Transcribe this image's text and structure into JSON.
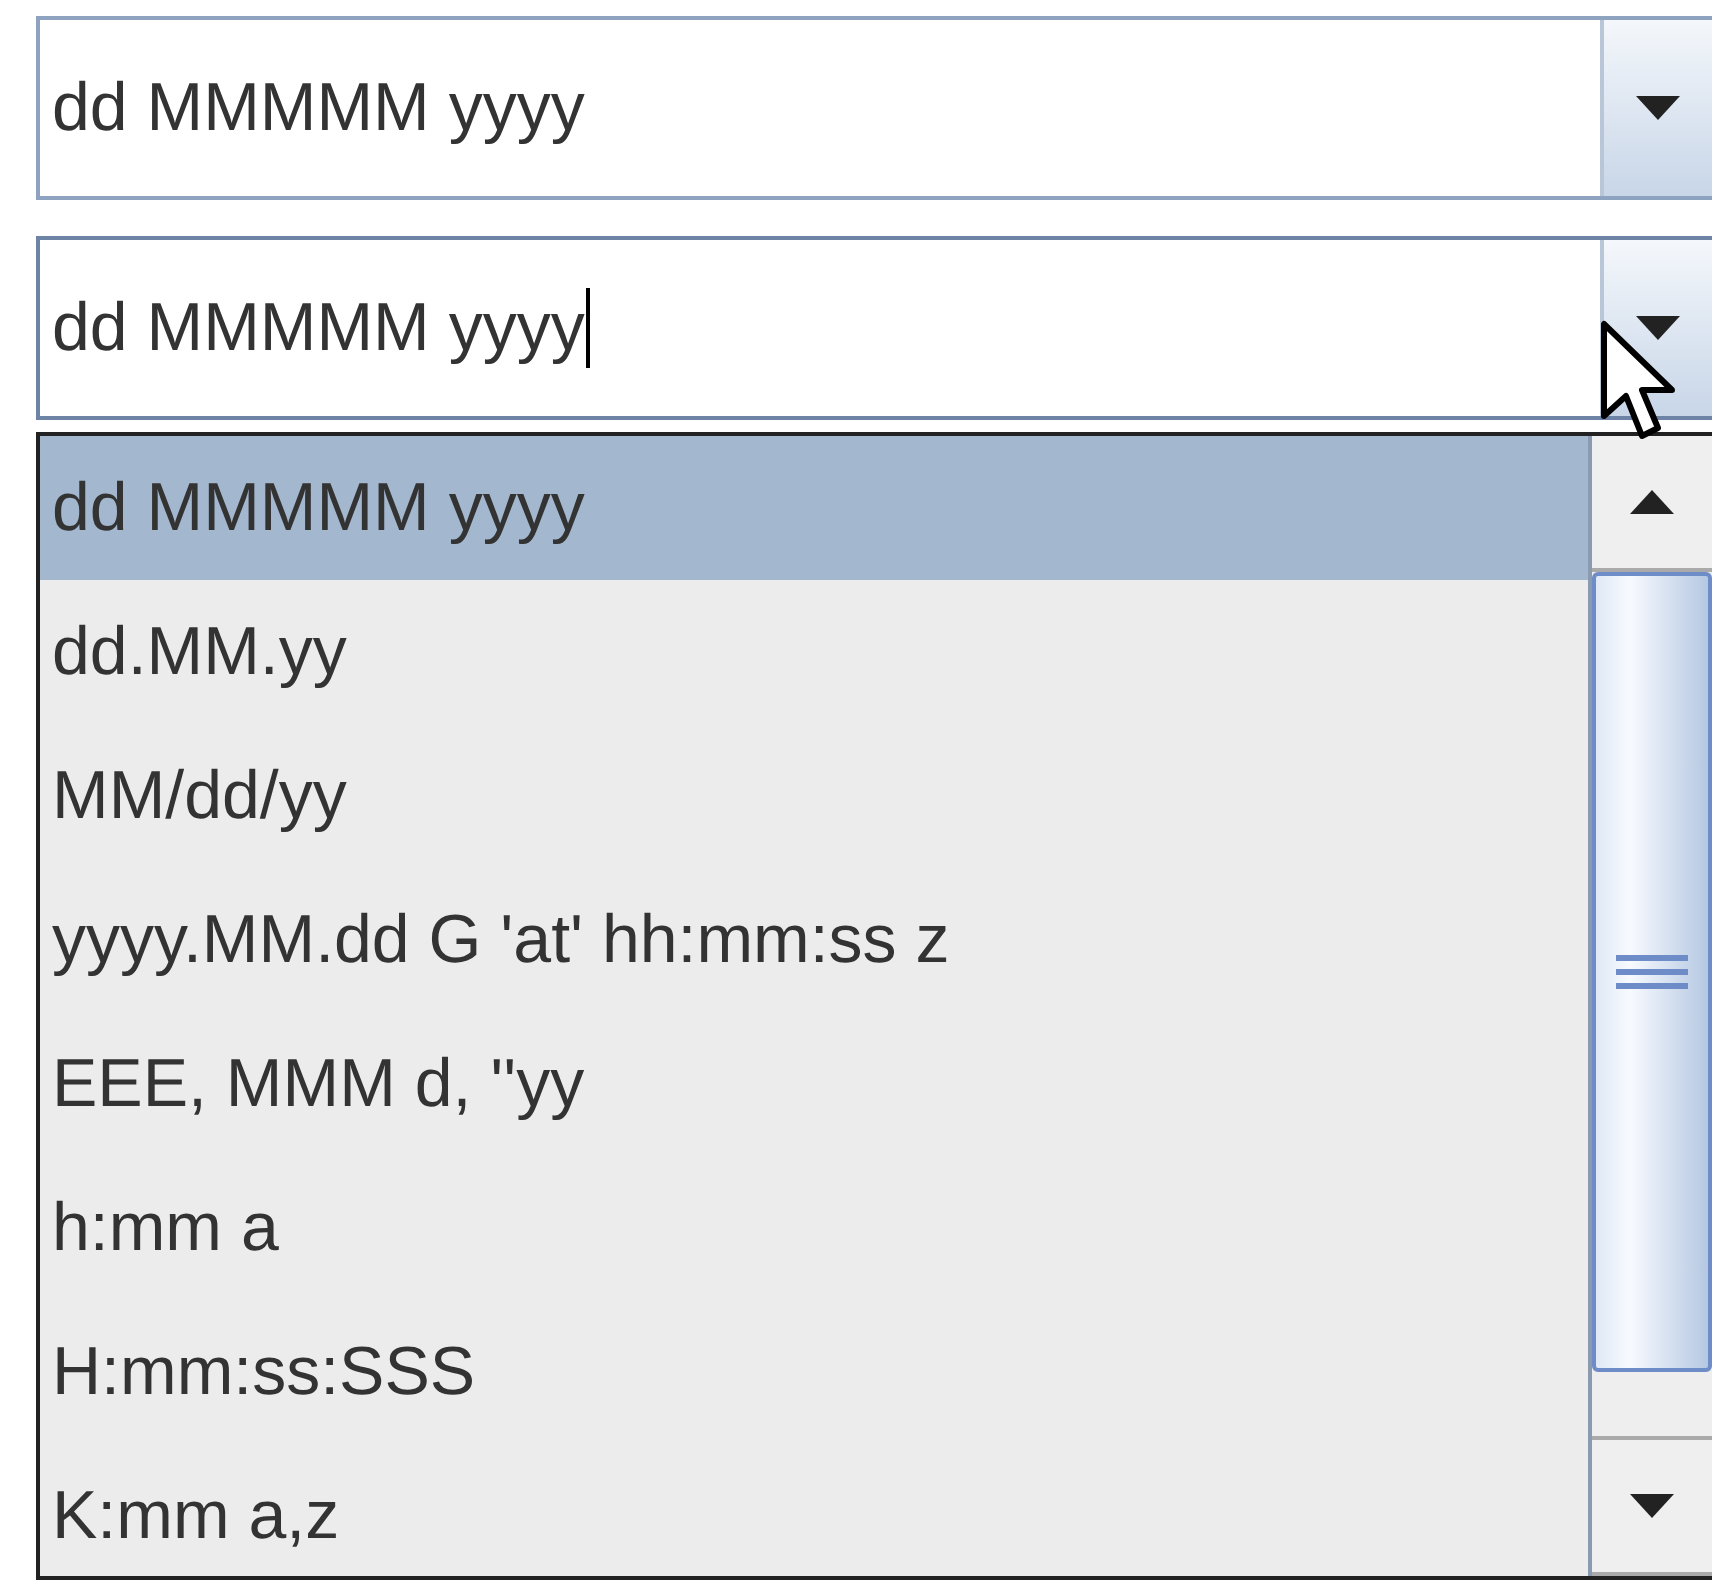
{
  "combo_boxes": [
    {
      "value": "dd MMMMM yyyy",
      "focused": false,
      "expanded": false
    },
    {
      "value": "dd MMMMM yyyy",
      "focused": true,
      "expanded": true,
      "options": [
        {
          "label": "dd MMMMM yyyy",
          "selected": true
        },
        {
          "label": "dd.MM.yy",
          "selected": false
        },
        {
          "label": "MM/dd/yy",
          "selected": false
        },
        {
          "label": "yyyy.MM.dd G 'at' hh:mm:ss z",
          "selected": false
        },
        {
          "label": "EEE, MMM d, ''yy",
          "selected": false
        },
        {
          "label": "h:mm a",
          "selected": false
        },
        {
          "label": "H:mm:ss:SSS",
          "selected": false
        },
        {
          "label": "K:mm a,z",
          "selected": false
        }
      ]
    }
  ]
}
